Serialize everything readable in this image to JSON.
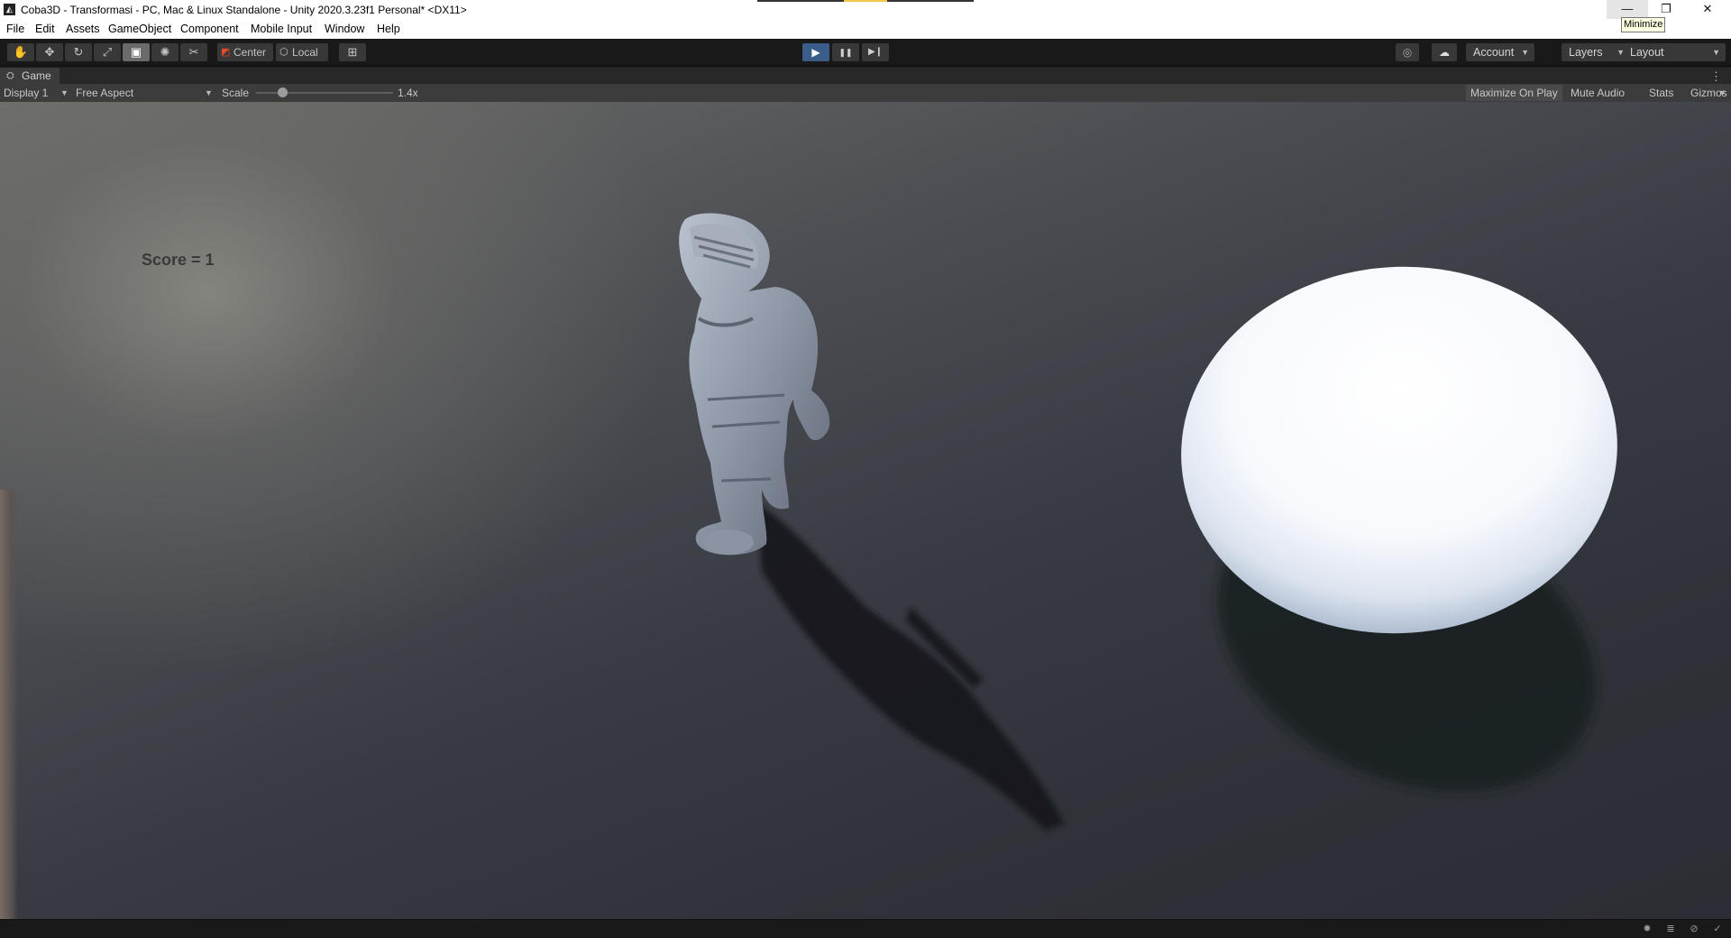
{
  "window": {
    "title": "Coba3D - Transformasi - PC, Mac & Linux Standalone - Unity 2020.3.23f1 Personal* <DX11>",
    "minimize_glyph": "—",
    "restore_glyph": "❐",
    "close_glyph": "✕",
    "tooltip": "Minimize",
    "app_icon_glyph": "◭"
  },
  "menu": [
    "File",
    "Edit",
    "Assets",
    "GameObject",
    "Component",
    "Mobile Input",
    "Window",
    "Help"
  ],
  "toolbar": {
    "tools": [
      {
        "name": "hand-tool-icon",
        "glyph": "✋"
      },
      {
        "name": "move-tool-icon",
        "glyph": "✥"
      },
      {
        "name": "rotate-tool-icon",
        "glyph": "↻"
      },
      {
        "name": "scale-tool-icon",
        "glyph": "⤢"
      },
      {
        "name": "rect-tool-icon",
        "glyph": "▣"
      },
      {
        "name": "transform-tool-icon",
        "glyph": "✺"
      },
      {
        "name": "custom-tool-icon",
        "glyph": "✂"
      }
    ],
    "pivot_label": "Center",
    "pivot_icon": "◩",
    "space_label": "Local",
    "space_icon": "⬡",
    "snap_icon": "⊞",
    "play_glyph": "▶",
    "pause_glyph": "❚❚",
    "step_glyph": "▶❙",
    "collab_icon": "◎",
    "cloud_icon": "☁",
    "account_label": "Account",
    "layers_label": "Layers",
    "layout_label": "Layout",
    "caret": "▼"
  },
  "game_tab": {
    "label": "Game",
    "icon": "⛭",
    "menu_glyph": "⋮"
  },
  "game_bar": {
    "display": "Display 1",
    "aspect": "Free Aspect",
    "scale_label": "Scale",
    "scale_value": "1.4x",
    "scale_fraction": 0.19,
    "maximize_on_play": "Maximize On Play",
    "mute_audio": "Mute Audio",
    "stats": "Stats",
    "gizmos": "Gizmos"
  },
  "hud": {
    "score": "Score = 1"
  },
  "status_icons": [
    "bug-icon",
    "layers-icon",
    "eye-off-icon",
    "check-icon"
  ]
}
